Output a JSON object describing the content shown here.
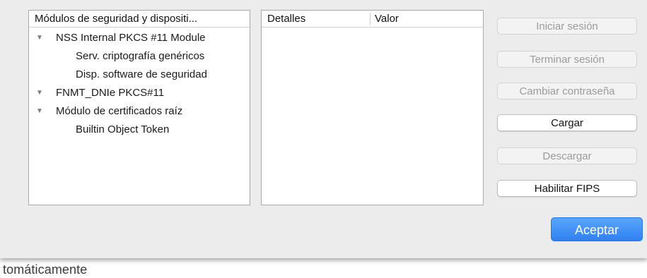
{
  "modules_panel": {
    "header": "Módulos de seguridad y dispositi...",
    "rows": [
      {
        "label": "NSS Internal PKCS #11 Module",
        "level": 0,
        "expanded": true
      },
      {
        "label": "Serv. criptografía genéricos",
        "level": 1
      },
      {
        "label": "Disp. software de seguridad",
        "level": 1
      },
      {
        "label": "FNMT_DNIe PKCS#11",
        "level": 0,
        "expanded": true
      },
      {
        "label": "Módulo de certificados raíz",
        "level": 0,
        "expanded": true
      },
      {
        "label": "Builtin Object Token",
        "level": 1
      }
    ],
    "expand_glyph": "▼"
  },
  "details_panel": {
    "col_details": "Detalles",
    "col_value": "Valor"
  },
  "buttons": {
    "login": "Iniciar sesión",
    "logout": "Terminar sesión",
    "change_password": "Cambiar contraseña",
    "load": "Cargar",
    "unload": "Descargar",
    "enable_fips": "Habilitar FIPS",
    "ok": "Aceptar"
  },
  "background_text": "tomáticamente",
  "colors": {
    "accent": "#2f80f4",
    "dialog_bg": "#ececec"
  }
}
